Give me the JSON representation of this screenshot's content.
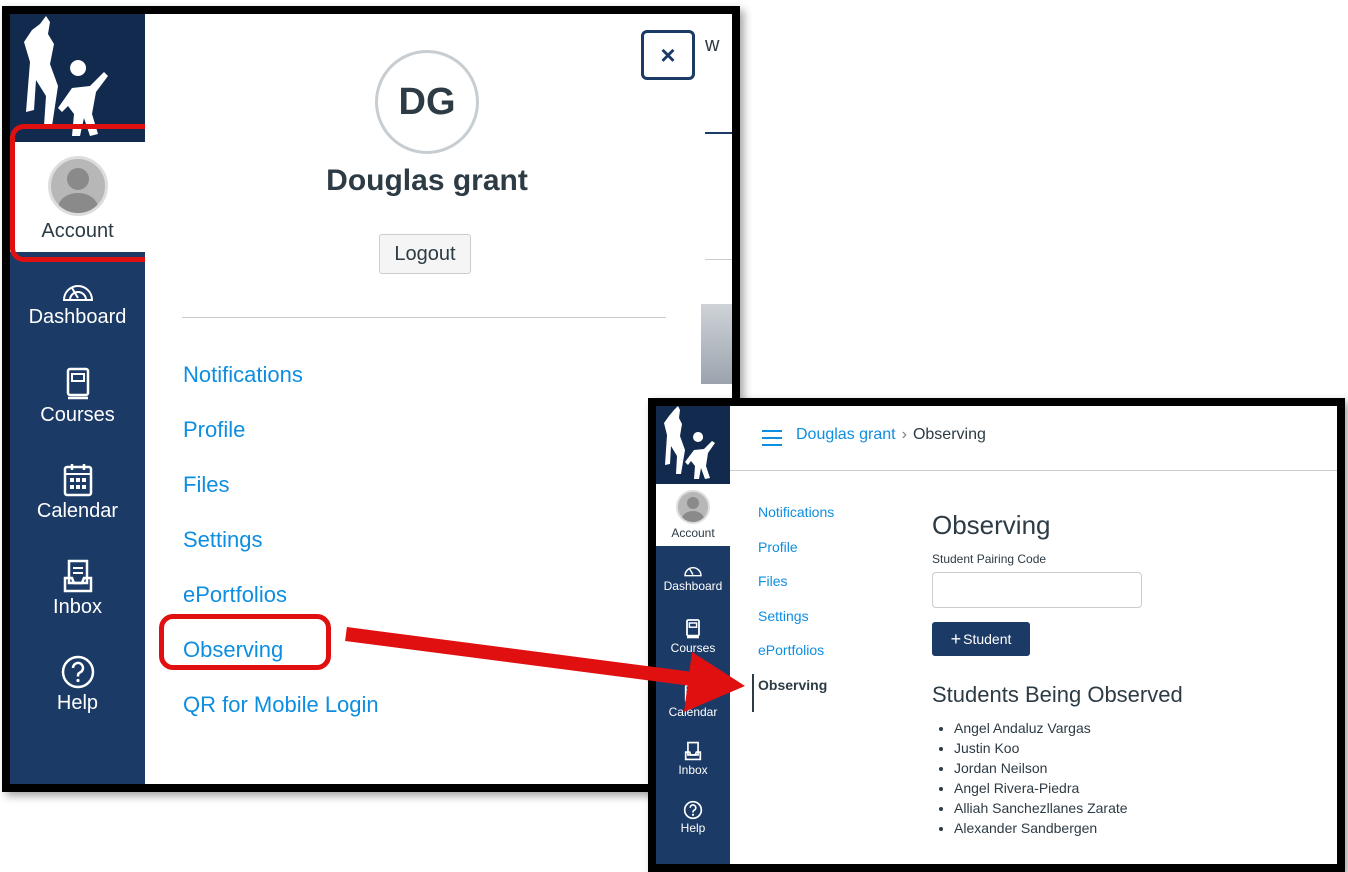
{
  "nav": {
    "account": "Account",
    "dashboard": "Dashboard",
    "courses": "Courses",
    "calendar": "Calendar",
    "inbox": "Inbox",
    "help": "Help"
  },
  "tray": {
    "initials": "DG",
    "user_name": "Douglas grant",
    "logout": "Logout",
    "close_symbol": "×",
    "links": [
      "Notifications",
      "Profile",
      "Files",
      "Settings",
      "ePortfolios",
      "Observing",
      "QR for Mobile Login"
    ]
  },
  "background_peek": {
    "text": "w"
  },
  "observing_page": {
    "breadcrumb": {
      "user": "Douglas grant",
      "separator": "›",
      "current": "Observing"
    },
    "subnav": [
      "Notifications",
      "Profile",
      "Files",
      "Settings",
      "ePortfolios",
      "Observing"
    ],
    "heading": "Observing",
    "pairing_label": "Student Pairing Code",
    "pairing_value": "",
    "add_student_plus": "+",
    "add_student_label": "Student",
    "students_heading": "Students Being Observed",
    "students": [
      "Angel Andaluz Vargas",
      "Justin Koo",
      "Jordan Neilson",
      "Angel Rivera-Piedra",
      "Alliah Sanchezllanes Zarate",
      "Alexander Sandbergen"
    ]
  },
  "colors": {
    "nav_bg": "#1b3a66",
    "link": "#0e8ee0",
    "highlight": "#e01010",
    "text": "#2d3b45"
  },
  "icons": [
    "school-logo-icon",
    "dashboard-icon",
    "courses-icon",
    "calendar-icon",
    "inbox-icon",
    "help-icon",
    "close-icon",
    "hamburger-icon",
    "arrow-icon"
  ]
}
